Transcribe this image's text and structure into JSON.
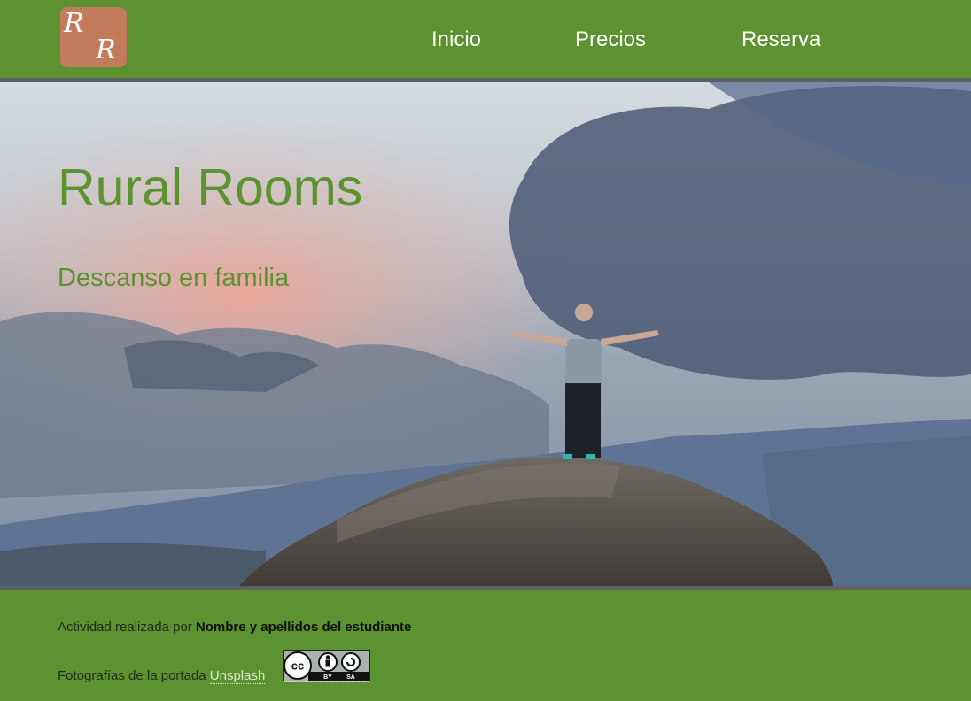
{
  "header": {
    "logo_letter_1": "R",
    "logo_letter_2": "R",
    "nav": [
      {
        "label": "Inicio"
      },
      {
        "label": "Precios"
      },
      {
        "label": "Reserva"
      }
    ]
  },
  "hero": {
    "title": "Rural Rooms",
    "subtitle": "Descanso en familia"
  },
  "footer": {
    "credit_prefix": "Actividad realizada por ",
    "credit_name": "Nombre y apellidos del estudiante",
    "photos_prefix": "Fotografías de la portada ",
    "photos_link": "Unsplash",
    "license_cc": "cc",
    "license_by": "BY",
    "license_sa": "SA"
  },
  "colors": {
    "brand_green": "#5c9230",
    "logo_bg": "#c27c5c",
    "divider_gray": "#5f6066"
  }
}
